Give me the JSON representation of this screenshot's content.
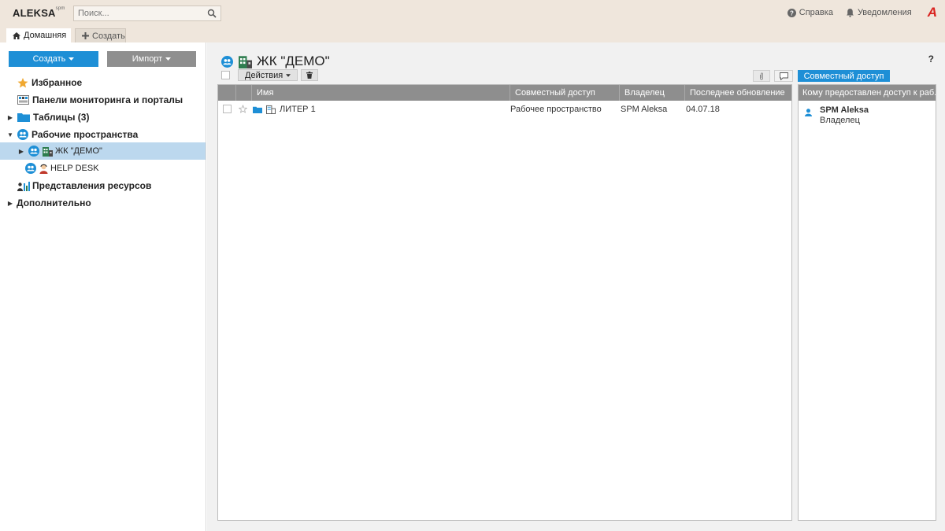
{
  "app": {
    "logo": "ALEKSA",
    "logo_sup": "spm",
    "search_placeholder": "Поиск...",
    "help_label": "Справка",
    "notifications_label": "Уведомления",
    "brand_mark": "A"
  },
  "tabs": {
    "home": "Домашняя",
    "create": "Создать"
  },
  "sidebar": {
    "create_button": "Создать",
    "import_button": "Импорт",
    "items": [
      {
        "label": "Избранное"
      },
      {
        "label": "Панели мониторинга и порталы"
      },
      {
        "label": "Таблицы (3)"
      },
      {
        "label": "Рабочие пространства"
      },
      {
        "label": "ЖК \"ДЕМО\""
      },
      {
        "label": "HELP DESK"
      },
      {
        "label": "Представления ресурсов"
      },
      {
        "label": "Дополнительно"
      }
    ]
  },
  "main": {
    "title": "ЖК \"ДЕМО\"",
    "help_q": "?",
    "actions_button": "Действия",
    "share_button": "Совместный доступ",
    "columns": [
      "Имя",
      "Совместный доступ",
      "Владелец",
      "Последнее обновление"
    ],
    "rows": [
      {
        "name": "ЛИТЕР 1",
        "sharing": "Рабочее пространство",
        "owner": "SPM Aleksa",
        "updated": "04.07.18"
      }
    ]
  },
  "access_panel": {
    "header": "Кому предоставлен доступ к раб...",
    "users": [
      {
        "name": "SPM Aleksa",
        "role": "Владелец"
      }
    ]
  },
  "colors": {
    "accent": "#1e8fd6",
    "topbar": "#efe6dc",
    "header_gray": "#8e8e8e",
    "selected_row": "#bcd8ee",
    "brand_red": "#d9231f"
  }
}
